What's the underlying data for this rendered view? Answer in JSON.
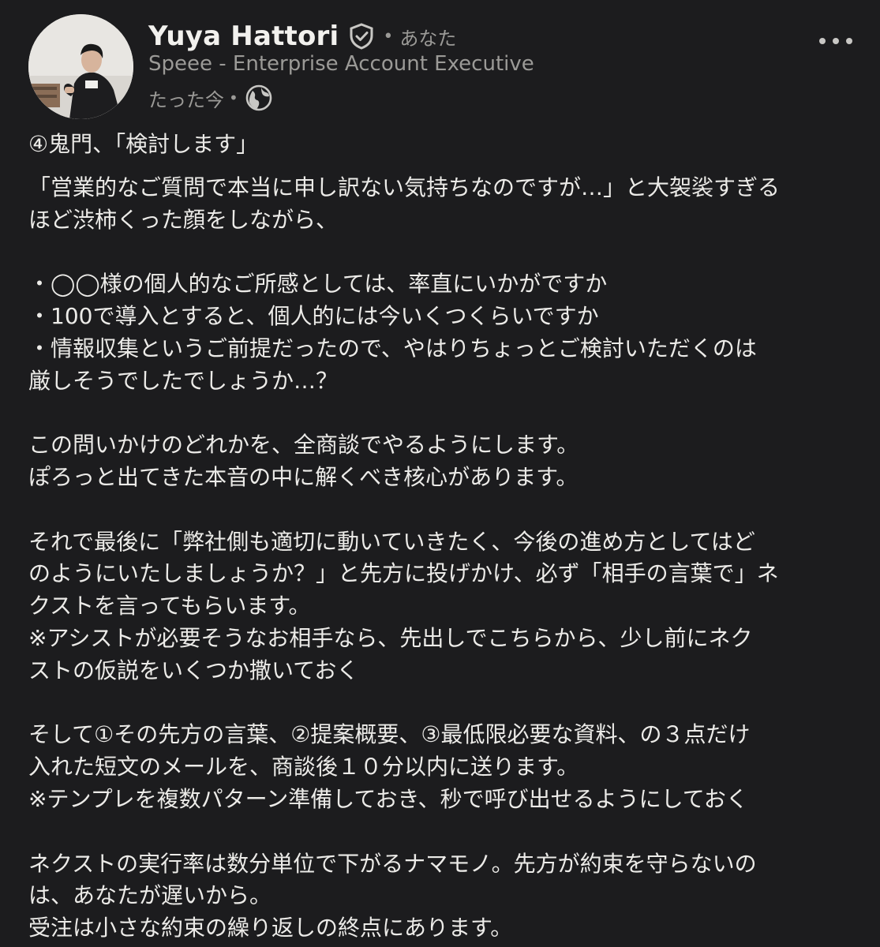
{
  "post": {
    "author": {
      "name": "Yuya Hattori",
      "verified_icon": "verified-shield-icon",
      "relation": "あなた",
      "headline": "Speee - Enterprise Account Executive",
      "timestamp": "たった今",
      "visibility_icon": "globe-icon"
    },
    "menu_icon": "more-horizontal-icon",
    "body": {
      "title": "④鬼門、「検討します」",
      "lines": [
        "「営業的なご質問で本当に申し訳ない気持ちなのですが…」と大袈裟すぎる",
        "ほど渋柿くった顔をしながら、",
        "",
        "・◯◯様の個人的なご所感としては、率直にいかがですか",
        "・100で導入とすると、個人的には今いくつくらいですか",
        "・情報収集というご前提だったので、やはりちょっとご検討いただくのは",
        "厳しそうでしたでしょうか…？",
        "",
        "この問いかけのどれかを、全商談でやるようにします。",
        "ぽろっと出てきた本音の中に解くべき核心があります。",
        "",
        "それで最後に「弊社側も適切に動いていきたく、今後の進め方としてはど",
        "のようにいたしましょうか？」と先方に投げかけ、必ず「相手の言葉で」ネ",
        "クストを言ってもらいます。",
        "※アシストが必要そうなお相手なら、先出しでこちらから、少し前にネク",
        "ストの仮説をいくつか撒いておく",
        "",
        "そして①その先方の言葉、②提案概要、③最低限必要な資料、の３点だけ",
        "入れた短文のメールを、商談後１０分以内に送ります。",
        "※テンプレを複数パターン準備しておき、秒で呼び出せるようにしておく",
        "",
        "ネクストの実行率は数分単位で下がるナマモノ。先方が約束を守らないの",
        "は、あなたが遅いから。",
        "受注は小さな約束の繰り返しの終点にあります。"
      ]
    }
  }
}
